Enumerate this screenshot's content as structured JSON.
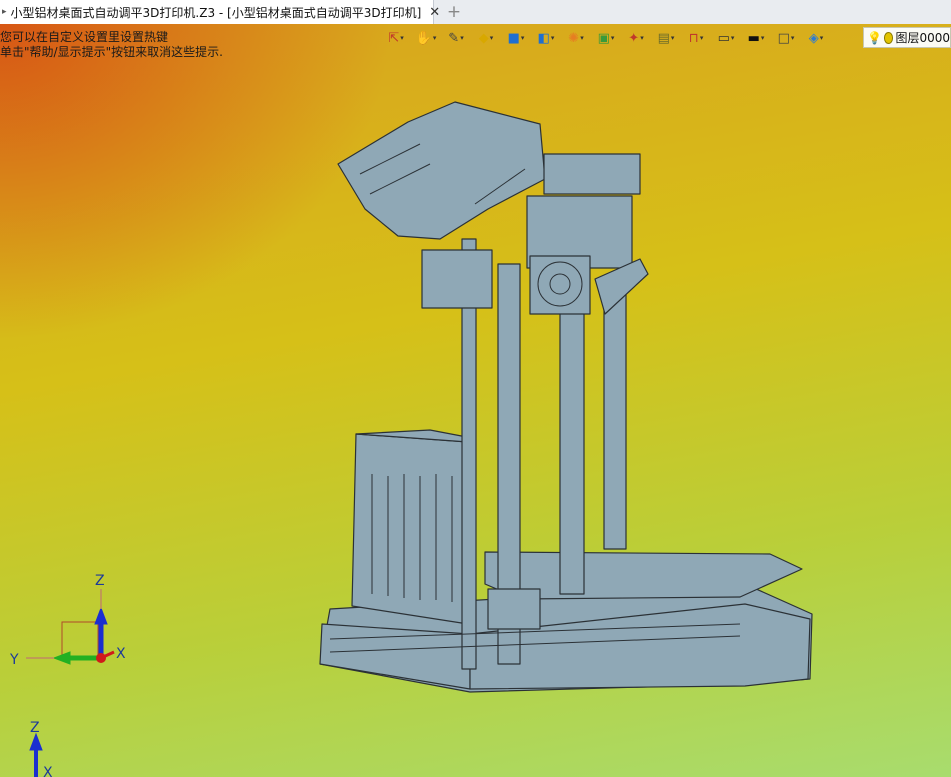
{
  "tab": {
    "title": "小型铝材桌面式自动调平3D打印机.Z3 - [小型铝材桌面式自动调平3D打印机]",
    "close_glyph": "✕",
    "new_tab_glyph": "+"
  },
  "hints": {
    "line1": "您可以在自定义设置里设置热键",
    "line2": "单击\"帮助/显示提示\"按钮来取消这些提示."
  },
  "toolbar": {
    "items": [
      {
        "name": "view-orient-icon",
        "glyph": "⇱",
        "color": "#c0392b"
      },
      {
        "name": "hand-tool-icon",
        "glyph": "✋",
        "color": "#2d8a2d"
      },
      {
        "name": "pencil-icon",
        "glyph": "✎",
        "color": "#444444"
      },
      {
        "name": "shaded-cube-icon",
        "glyph": "◆",
        "color": "#d8a800"
      },
      {
        "name": "blue-cube-icon",
        "glyph": "■",
        "color": "#1f6fd0"
      },
      {
        "name": "views-icon",
        "glyph": "◧",
        "color": "#1f6fd0"
      },
      {
        "name": "render-mode-icon",
        "glyph": "✺",
        "color": "#e67e22"
      },
      {
        "name": "display-icon",
        "glyph": "▣",
        "color": "#3a9a3a"
      },
      {
        "name": "snap-icon",
        "glyph": "✦",
        "color": "#c0392b"
      },
      {
        "name": "box-icon",
        "glyph": "▤",
        "color": "#6b6b2a"
      },
      {
        "name": "measure-icon",
        "glyph": "⊓",
        "color": "#c0392b"
      },
      {
        "name": "monitor-icon",
        "glyph": "▭",
        "color": "#333333"
      },
      {
        "name": "line-weight-icon",
        "glyph": "▬",
        "color": "#111111"
      },
      {
        "name": "color-box-icon",
        "glyph": "□",
        "color": "#444444"
      },
      {
        "name": "layers-stack-icon",
        "glyph": "◈",
        "color": "#2b7bd6"
      }
    ]
  },
  "layer": {
    "label": "图层0000",
    "bulb_color": "#f2d23a",
    "circle_color": "#e2c400"
  },
  "axes": {
    "triad1": {
      "z": "Z",
      "y": "Y",
      "x": "X"
    },
    "triad2": {
      "z": "Z",
      "x": "X"
    }
  },
  "colors": {
    "part_fill": "#8fa8b6",
    "part_stroke": "#2b3136",
    "axis_z": "#1a2fd0",
    "axis_y": "#22b022",
    "axis_x": "#d01a1a"
  }
}
